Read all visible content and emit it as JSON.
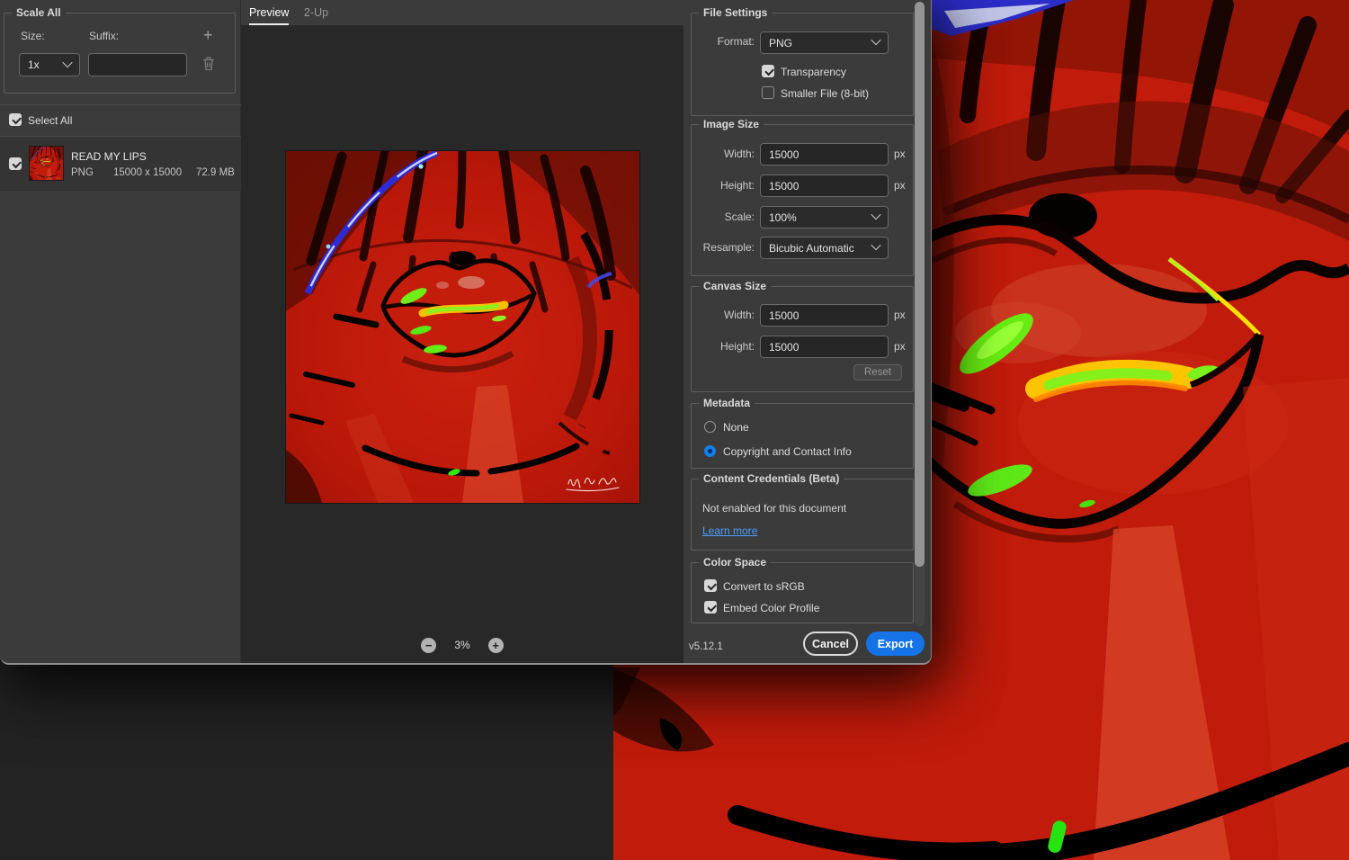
{
  "colors": {
    "accent_blue": "#1473e6",
    "link_blue": "#4da1ff",
    "panel_bg": "#3b3b3b",
    "stage_bg": "#282828",
    "artwork_red": "#c01b0b"
  },
  "left_panel": {
    "scale_all": {
      "title": "Scale All",
      "size_label": "Size:",
      "suffix_label": "Suffix:",
      "size_value": "1x",
      "suffix_value": "",
      "add_icon": "plus-icon",
      "remove_icon": "trash-icon"
    },
    "select_all": {
      "label": "Select All",
      "checked": true
    },
    "files": [
      {
        "name": "READ MY LIPS",
        "format": "PNG",
        "dimensions": "15000 x 15000",
        "file_size": "72.9 MB",
        "checked": true,
        "thumbnail": "red-lips-artwork"
      }
    ]
  },
  "preview": {
    "tabs": [
      {
        "label": "Preview",
        "active": true
      },
      {
        "label": "2-Up",
        "active": false
      }
    ],
    "zoom_out_icon": "minus-circle-icon",
    "zoom_in_icon": "plus-circle-icon",
    "zoom_level": "3%",
    "image": "red-lips-artwork-preview"
  },
  "file_settings": {
    "title": "File Settings",
    "format_label": "Format:",
    "format_value": "PNG",
    "options": [
      {
        "label": "Transparency",
        "checked": true
      },
      {
        "label": "Smaller File (8-bit)",
        "checked": false
      }
    ]
  },
  "image_size": {
    "title": "Image Size",
    "width_label": "Width:",
    "width_value": "15000",
    "height_label": "Height:",
    "height_value": "15000",
    "unit": "px",
    "scale_label": "Scale:",
    "scale_value": "100%",
    "resample_label": "Resample:",
    "resample_value": "Bicubic Automatic"
  },
  "canvas_size": {
    "title": "Canvas Size",
    "width_label": "Width:",
    "width_value": "15000",
    "height_label": "Height:",
    "height_value": "15000",
    "unit": "px",
    "reset_label": "Reset"
  },
  "metadata": {
    "title": "Metadata",
    "options": [
      {
        "label": "None",
        "selected": false
      },
      {
        "label": "Copyright and Contact Info",
        "selected": true
      }
    ]
  },
  "content_credentials": {
    "title": "Content Credentials (Beta)",
    "status": "Not enabled for this document",
    "link_label": "Learn more"
  },
  "color_space": {
    "title": "Color Space",
    "options": [
      {
        "label": "Convert to sRGB",
        "checked": true
      },
      {
        "label": "Embed Color Profile",
        "checked": true
      }
    ]
  },
  "footer": {
    "version": "v5.12.1",
    "cancel_label": "Cancel",
    "export_label": "Export"
  }
}
